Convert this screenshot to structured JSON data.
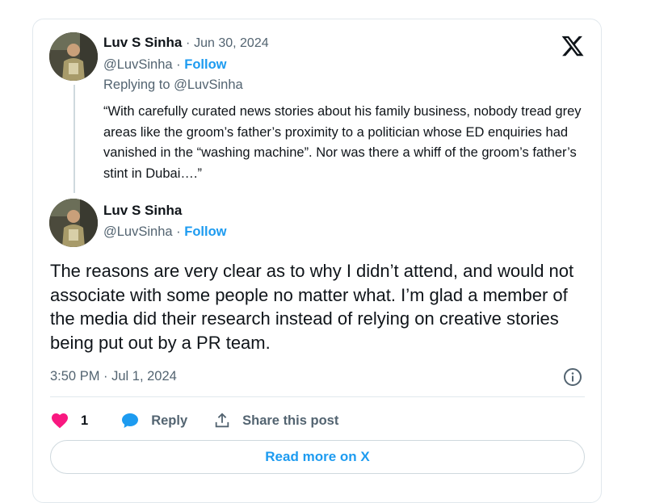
{
  "reply_tweet": {
    "author_name": "Luv S Sinha",
    "date": "Jun 30, 2024",
    "handle": "@LuvSinha",
    "separator": "·",
    "follow_label": "Follow",
    "replying_to": "Replying to @LuvSinha",
    "text": "“With carefully curated news stories about his family business, nobody tread grey areas like the groom’s father’s proximity to a politician whose ED enquiries had vanished in the “washing machine”. Nor was there a whiff of the groom’s father’s stint in Dubai….”"
  },
  "main_tweet": {
    "author_name": "Luv S Sinha",
    "handle": "@LuvSinha",
    "separator": "·",
    "follow_label": "Follow",
    "text": "The reasons are very clear as to why I didn’t attend, and would not associate with some people no matter what. I’m glad a member of the media did their research instead of relying on creative stories being put out by a PR team.",
    "timestamp": "3:50 PM · Jul 1, 2024"
  },
  "actions": {
    "like_count": "1",
    "reply_label": "Reply",
    "share_label": "Share this post"
  },
  "read_more_label": "Read more on X",
  "icons": [
    "x-logo-icon",
    "info-icon",
    "heart-icon",
    "speech-bubble-icon",
    "share-icon"
  ],
  "colors": {
    "accent": "#1d9bf0",
    "heart": "#f91880",
    "secondary_text": "#536471",
    "primary_text": "#0f1419",
    "border": "#e1e8ed"
  }
}
